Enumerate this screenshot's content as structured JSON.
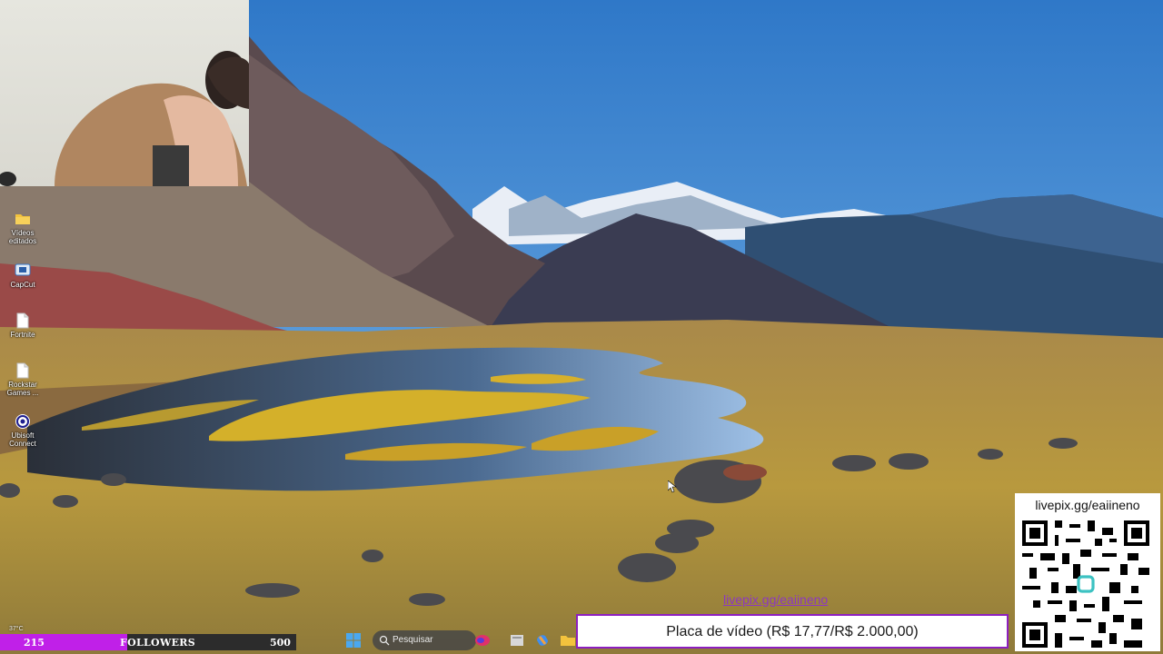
{
  "desktop_icons": [
    {
      "label": "Vídeos editados",
      "icon": "folder-icon"
    },
    {
      "label": "CapCut",
      "icon": "capcut-icon"
    },
    {
      "label": "Fortnite",
      "icon": "file-icon"
    },
    {
      "label": "Rockstar Games ...",
      "icon": "file-icon"
    },
    {
      "label": "Ubisoft Connect",
      "icon": "ubisoft-icon"
    }
  ],
  "stream_overlay": {
    "followers": {
      "current": "215",
      "label": "FOLLOWERS",
      "goal": "500",
      "progress_fraction": 0.43,
      "fill_color": "#c020e8"
    },
    "goal_banner": "Placa de vídeo (R$ 17,77/R$ 2.000,00)",
    "watermark_link": "livepix.gg/eaiineno",
    "qr_panel": {
      "url": "livepix.gg/eaiineno"
    }
  },
  "taskbar": {
    "temperature": "37°C",
    "search_placeholder": "Pesquisar",
    "apps": [
      "start-icon",
      "search-icon",
      "app-icon",
      "file-explorer-icon",
      "copilot-icon",
      "folder-icon"
    ]
  },
  "colors": {
    "accent_purple": "#8d1fc0",
    "sky": "#3f84c8"
  }
}
